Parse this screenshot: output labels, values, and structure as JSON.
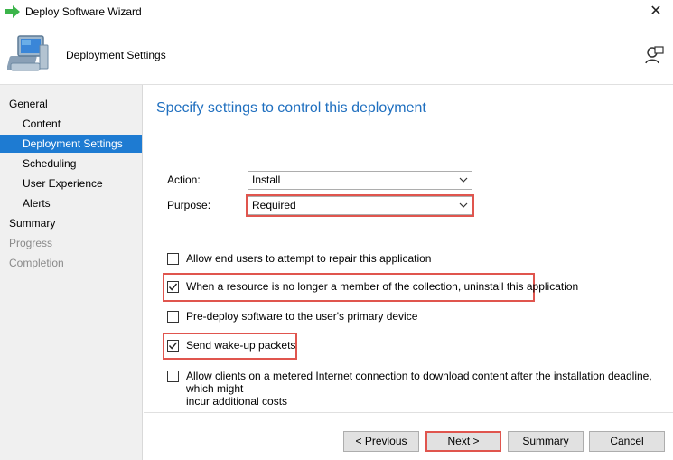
{
  "window": {
    "title": "Deploy Software Wizard",
    "close_glyph": "✕"
  },
  "header": {
    "page_heading": "Deployment Settings"
  },
  "nav": {
    "items": [
      {
        "label": "General",
        "state": "normal"
      },
      {
        "label": "Content",
        "state": "normal"
      },
      {
        "label": "Deployment Settings",
        "state": "selected"
      },
      {
        "label": "Scheduling",
        "state": "normal"
      },
      {
        "label": "User Experience",
        "state": "normal"
      },
      {
        "label": "Alerts",
        "state": "normal"
      },
      {
        "label": "Summary",
        "state": "normal"
      },
      {
        "label": "Progress",
        "state": "disabled"
      },
      {
        "label": "Completion",
        "state": "disabled"
      }
    ]
  },
  "main": {
    "title": "Specify settings to control this deployment",
    "action": {
      "label": "Action:",
      "value": "Install"
    },
    "purpose": {
      "label": "Purpose:",
      "value": "Required"
    },
    "options": [
      {
        "label": "Allow end users to attempt to repair this application",
        "checked": false
      },
      {
        "label": "When a resource is no longer a member of the collection, uninstall this application",
        "checked": true
      },
      {
        "label": "Pre-deploy software to the user's primary device",
        "checked": false
      },
      {
        "label": "Send wake-up packets",
        "checked": true
      },
      {
        "label": "Allow clients on a metered Internet connection to download content after the installation deadline, which might",
        "label_line2": "incur additional costs",
        "checked": false
      }
    ]
  },
  "buttons": {
    "previous": "< Previous",
    "next": "Next >",
    "summary": "Summary",
    "cancel": "Cancel"
  },
  "colors": {
    "accent": "#1e7bd2",
    "title_blue": "#1f6fbf",
    "highlight_red": "#e0554e"
  }
}
